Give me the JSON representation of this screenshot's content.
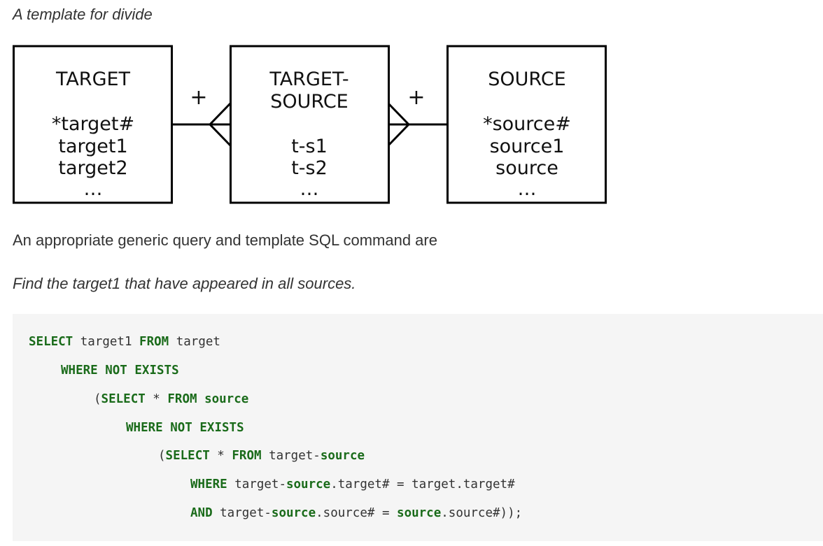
{
  "caption": "A template for divide",
  "diagram": {
    "target": {
      "title": "TARGET",
      "fields": [
        "*target#",
        "target1",
        "target2",
        "…"
      ]
    },
    "target_source": {
      "title_lines": [
        "TARGET-",
        "SOURCE"
      ],
      "fields": [
        "t-s1",
        "t-s2",
        "…"
      ]
    },
    "source": {
      "title": "SOURCE",
      "fields": [
        "*source#",
        "source1",
        "source",
        "…"
      ]
    },
    "left_relation_symbol": "+",
    "right_relation_symbol": "+"
  },
  "paragraph": "An appropriate generic query and template SQL command are",
  "question": "Find the target1 that have appeared in all sources.",
  "code": {
    "lines": [
      [
        {
          "t": "SELECT",
          "k": true
        },
        {
          "t": " target1 "
        },
        {
          "t": "FROM",
          "k": true
        },
        {
          "t": " target"
        }
      ],
      [
        {
          "t": "WHERE",
          "k": true
        },
        {
          "t": " "
        },
        {
          "t": "NOT",
          "k": true
        },
        {
          "t": " "
        },
        {
          "t": "EXISTS",
          "k": true
        }
      ],
      [
        {
          "t": "("
        },
        {
          "t": "SELECT",
          "k": true
        },
        {
          "t": " * "
        },
        {
          "t": "FROM",
          "k": true
        },
        {
          "t": " "
        },
        {
          "t": "source",
          "k": true
        }
      ],
      [
        {
          "t": "WHERE",
          "k": true
        },
        {
          "t": " "
        },
        {
          "t": "NOT",
          "k": true
        },
        {
          "t": " "
        },
        {
          "t": "EXISTS",
          "k": true
        }
      ],
      [
        {
          "t": "("
        },
        {
          "t": "SELECT",
          "k": true
        },
        {
          "t": " * "
        },
        {
          "t": "FROM",
          "k": true
        },
        {
          "t": " target-"
        },
        {
          "t": "source",
          "k": true
        }
      ],
      [
        {
          "t": "WHERE",
          "k": true
        },
        {
          "t": " target-"
        },
        {
          "t": "source",
          "k": true
        },
        {
          "t": ".target# = target.target#"
        }
      ],
      [
        {
          "t": "AND",
          "k": true
        },
        {
          "t": " target-"
        },
        {
          "t": "source",
          "k": true
        },
        {
          "t": ".source# = "
        },
        {
          "t": "source",
          "k": true
        },
        {
          "t": ".source#));"
        }
      ]
    ]
  }
}
